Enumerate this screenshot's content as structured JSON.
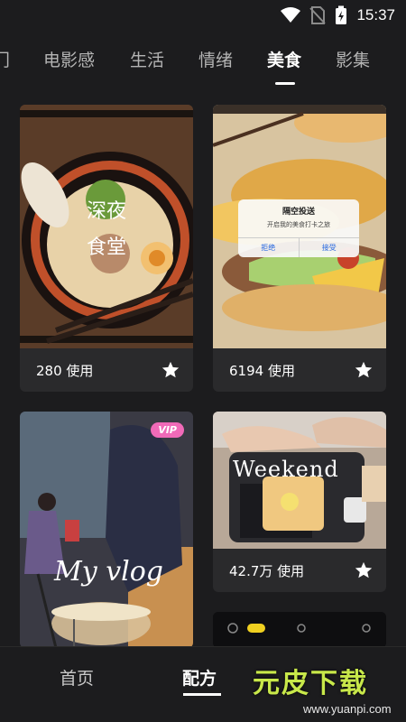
{
  "status_bar": {
    "time": "15:37"
  },
  "tabs": [
    "门",
    "电影感",
    "生活",
    "情绪",
    "美食",
    "影集"
  ],
  "active_tab": "美食",
  "cards": [
    {
      "count": "280 使用",
      "overlay_text_1": "深夜",
      "overlay_text_2": "食堂"
    },
    {
      "count": "6194 使用",
      "dialog_title": "隔空投送",
      "dialog_body": "开启我的美食打卡之旅",
      "dialog_decline": "拒绝",
      "dialog_accept": "接受"
    },
    {
      "badge": "VIP",
      "overlay_text": "My vlog"
    },
    {
      "count": "42.7万 使用",
      "overlay_text": "Weekend"
    }
  ],
  "bottom_nav": {
    "items": [
      "首页",
      "配方"
    ]
  },
  "watermark": {
    "title": "元皮下载",
    "url": "www.yuanpi.com"
  }
}
